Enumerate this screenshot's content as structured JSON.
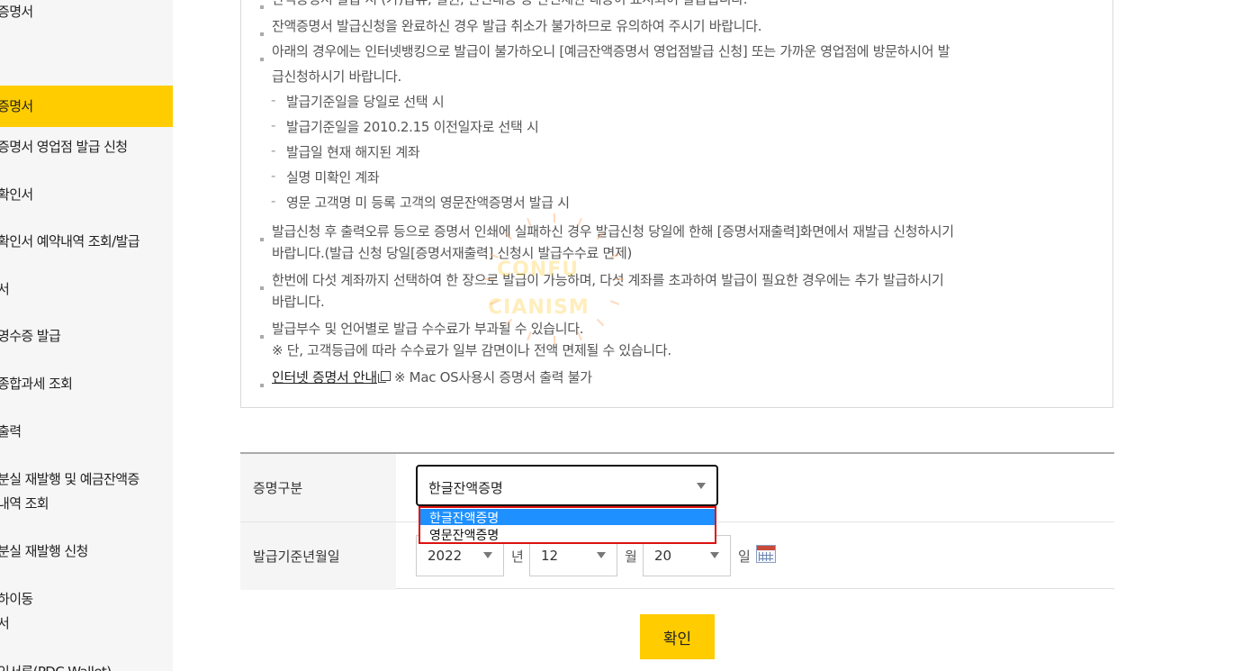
{
  "sidebar": {
    "items": [
      {
        "lines": [
          "증명서"
        ],
        "active": false
      },
      {
        "lines": [
          "증명서"
        ],
        "active": true
      },
      {
        "lines": [
          "증명서 영업점 발급 신청"
        ],
        "active": false
      },
      {
        "lines": [
          "확인서"
        ],
        "active": false
      },
      {
        "lines": [
          "확인서 예약내역 조회/발급"
        ],
        "active": false
      },
      {
        "lines": [
          "서"
        ],
        "active": false
      },
      {
        "lines": [
          "영수증 발급"
        ],
        "active": false
      },
      {
        "lines": [
          "종합과세 조회"
        ],
        "active": false
      },
      {
        "lines": [
          "출력"
        ],
        "active": false
      },
      {
        "lines": [
          "분실 재발행 및 예금잔액증",
          "내역 조회"
        ],
        "active": false
      },
      {
        "lines": [
          "분실 재발행 신청"
        ],
        "active": false
      },
      {
        "lines": [
          "하이동",
          "서"
        ],
        "active": false
      },
      {
        "lines": [
          "인서류(PDC Wallet)"
        ],
        "active": false
      }
    ]
  },
  "notice": {
    "items": [
      {
        "type": "bullet",
        "lines": [
          "잔액증명서 발급 시 (가)압류, 질권, 관련내용 등 관련제한 내용이 표시되어 발급됩니다."
        ]
      },
      {
        "type": "bullet",
        "lines": [
          "잔액증명서 발급신청을 완료하신 경우 발급 취소가 불가하므로 유의하여 주시기 바랍니다."
        ]
      },
      {
        "type": "bullet",
        "lines": [
          "아래의 경우에는 인터넷뱅킹으로 발급이 불가하오니 [예금잔액증명서 영업점발급 신청] 또는 가까운 영업점에 방문하시어 발",
          "급신청하시기 바랍니다."
        ]
      },
      {
        "type": "dash",
        "lines": [
          "발급기준일을 당일로 선택 시"
        ]
      },
      {
        "type": "dash",
        "lines": [
          "발급기준일을 2010.2.15 이전일자로 선택 시"
        ]
      },
      {
        "type": "dash",
        "lines": [
          "발급일 현재 해지된 계좌"
        ]
      },
      {
        "type": "dash",
        "lines": [
          "실명 미확인 계좌"
        ]
      },
      {
        "type": "dash",
        "lines": [
          "영문 고객명 미 등록 고객의 영문잔액증명서 발급 시"
        ]
      },
      {
        "type": "bullet",
        "lines": [
          "발급신청 후 출력오류 등으로 증명서 인쇄에 실패하신 경우 발급신청 당일에 한해 [증명서재출력]화면에서 재발급 신청하시기",
          "바랍니다.(발급 신청 당일[증명서재출력] 신청시 발급수수료 면제)"
        ]
      },
      {
        "type": "bullet",
        "lines": [
          "한번에 다섯 계좌까지 선택하여 한 장으로 발급이 가능하며, 다섯 계좌를 초과하여 발급이 필요한 경우에는 추가 발급하시기",
          "바랍니다."
        ]
      },
      {
        "type": "bullet",
        "lines": [
          "발급부수 및 언어별로 발급 수수료가 부과될 수 있습니다.",
          "※ 단, 고객등급에 따라 수수료가 일부 감면이나 전액 면제될 수 있습니다."
        ]
      }
    ],
    "guide_link": "인터넷 증명서 안내",
    "guide_note": "※ Mac OS사용시 증명서 출력 불가"
  },
  "watermark": {
    "line1": "CONFU",
    "line2": "CIANISM"
  },
  "form": {
    "cert_type_label": "증명구분",
    "cert_type_value": "한글잔액증명",
    "cert_type_options": [
      "한글잔액증명",
      "영문잔액증명"
    ],
    "date_label": "발급기준년월일",
    "year": "2022",
    "year_unit": "년",
    "month": "12",
    "month_unit": "월",
    "day": "20",
    "day_unit": "일"
  },
  "confirm_label": "확인",
  "colors": {
    "accent": "#ffcc00",
    "dropdown_highlight": "#1e90ff",
    "dropdown_border": "#dd1111"
  }
}
